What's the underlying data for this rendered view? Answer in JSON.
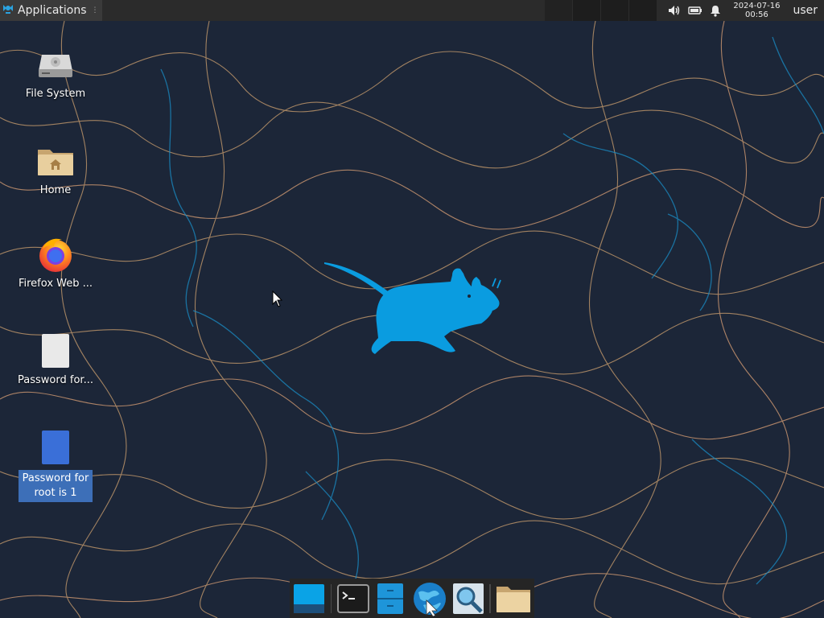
{
  "panel": {
    "applications_label": "Applications",
    "applications_icon": "xfce-mouse-icon",
    "clock_date": "2024-07-16",
    "clock_time": "00:56",
    "user": "user",
    "tray_icons": [
      "volume-icon",
      "battery-icon",
      "notification-bell-icon"
    ]
  },
  "desktop_icons": [
    {
      "label": "File System",
      "icon": "drive-icon"
    },
    {
      "label": "Home",
      "icon": "home-folder-icon"
    },
    {
      "label": "Firefox Web ...",
      "icon": "firefox-icon"
    },
    {
      "label": "Password for...",
      "icon": "text-file-icon"
    },
    {
      "label": "Password for root is 1",
      "icon": "text-file-selected-icon",
      "selected": true
    }
  ],
  "dock": {
    "items": [
      "show-desktop-icon",
      "terminal-icon",
      "file-manager-icon",
      "web-browser-icon",
      "app-finder-icon",
      "folder-icon"
    ]
  },
  "colors": {
    "accent": "#0a9ce0",
    "selection": "#3d6fb8",
    "panel": "#2b2b2b"
  }
}
